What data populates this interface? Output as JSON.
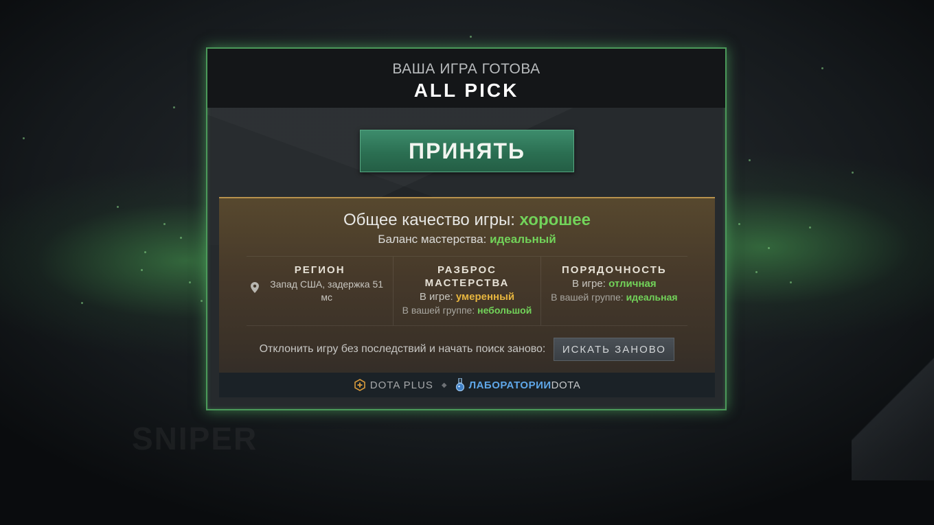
{
  "header": {
    "subtitle": "ВАША ИГРА ГОТОВА",
    "mode": "ALL PICK"
  },
  "accept_button": "ПРИНЯТЬ",
  "quality": {
    "title_prefix": "Общее качество игры:",
    "title_value": "хорошее",
    "balance_prefix": "Баланс мастерства:",
    "balance_value": "идеальный"
  },
  "region": {
    "heading": "РЕГИОН",
    "value": "Запад США, задержка 51 мс"
  },
  "skill_spread": {
    "heading_line1": "РАЗБРОС",
    "heading_line2": "МАСТЕРСТВА",
    "in_game_label": "В игре:",
    "in_game_value": "умеренный",
    "in_group_label": "В вашей группе:",
    "in_group_value": "небольшой"
  },
  "decency": {
    "heading": "ПОРЯДОЧНОСТЬ",
    "in_game_label": "В игре:",
    "in_game_value": "отличная",
    "in_group_label": "В вашей группе:",
    "in_group_value": "идеальная"
  },
  "research": {
    "label": "Отклонить игру без последствий и начать поиск заново:",
    "button": "ИСКАТЬ ЗАНОВО"
  },
  "footer": {
    "dota_plus": "DOTA PLUS",
    "labs_part1": "ЛАБОРАТОРИИ",
    "labs_part2": "DOTA"
  },
  "colors": {
    "accent_green": "#72d35a",
    "accent_yellow": "#e6b53f",
    "border_green": "#4b9a5a",
    "accept_button": "#2b6f52"
  },
  "icons": [
    "map-pin-icon",
    "dota-plus-icon",
    "flask-icon"
  ]
}
